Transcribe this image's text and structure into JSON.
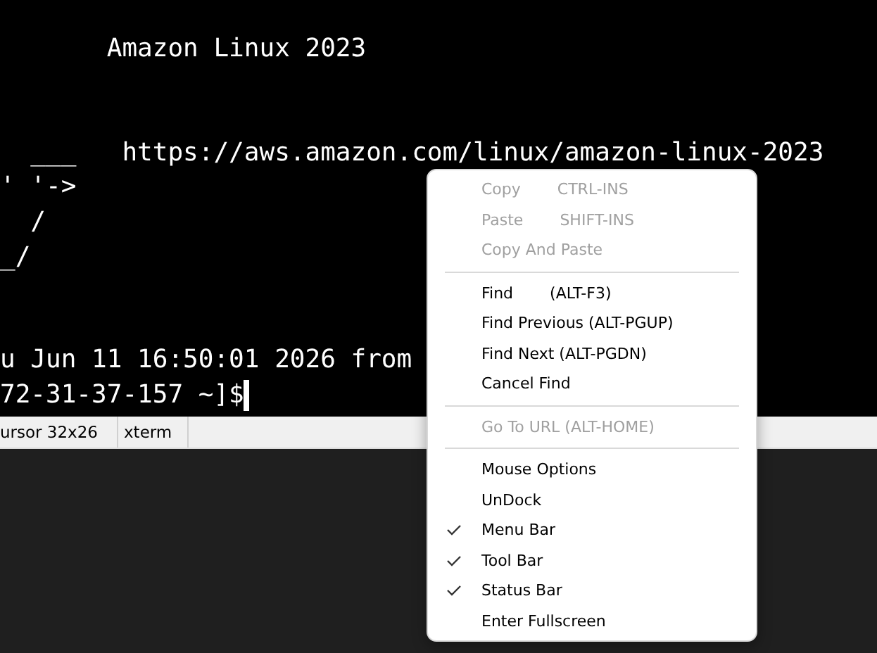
{
  "terminal": {
    "blocks": [
      [
        "       Amazon Linux 2023"
      ],
      [
        "  ___   https://aws.amazon.com/linux/amazon-linux-2023",
        "' '->",
        "  /",
        "_/"
      ],
      [
        "u Jun 11 16:50:01 2026 from",
        "72-31-37-157 ~]$"
      ]
    ]
  },
  "status_bar": [
    "ursor 32x26",
    "xterm"
  ],
  "context_menu": [
    {
      "kind": "item",
      "label": "Copy",
      "shortcut": "CTRL-INS",
      "disabled": true,
      "checked": false
    },
    {
      "kind": "item",
      "label": "Paste",
      "shortcut": "SHIFT-INS",
      "disabled": true,
      "checked": false
    },
    {
      "kind": "item",
      "label": "Copy And Paste",
      "disabled": true,
      "checked": false
    },
    {
      "kind": "separator"
    },
    {
      "kind": "item",
      "label": "Find",
      "shortcut": "(ALT-F3)",
      "disabled": false,
      "checked": false
    },
    {
      "kind": "item",
      "label": "Find Previous (ALT-PGUP)",
      "disabled": false,
      "checked": false
    },
    {
      "kind": "item",
      "label": "Find Next (ALT-PGDN)",
      "disabled": false,
      "checked": false
    },
    {
      "kind": "item",
      "label": "Cancel Find",
      "disabled": false,
      "checked": false
    },
    {
      "kind": "separator"
    },
    {
      "kind": "item",
      "label": "Go To URL (ALT-HOME)",
      "disabled": true,
      "checked": false
    },
    {
      "kind": "separator"
    },
    {
      "kind": "item",
      "label": "Mouse Options",
      "disabled": false,
      "checked": false
    },
    {
      "kind": "item",
      "label": "UnDock",
      "disabled": false,
      "checked": false
    },
    {
      "kind": "item",
      "label": "Menu Bar",
      "disabled": false,
      "checked": true
    },
    {
      "kind": "item",
      "label": "Tool Bar",
      "disabled": false,
      "checked": true
    },
    {
      "kind": "item",
      "label": "Status Bar",
      "disabled": false,
      "checked": true
    },
    {
      "kind": "item",
      "label": "Enter Fullscreen",
      "disabled": false,
      "checked": false
    }
  ]
}
